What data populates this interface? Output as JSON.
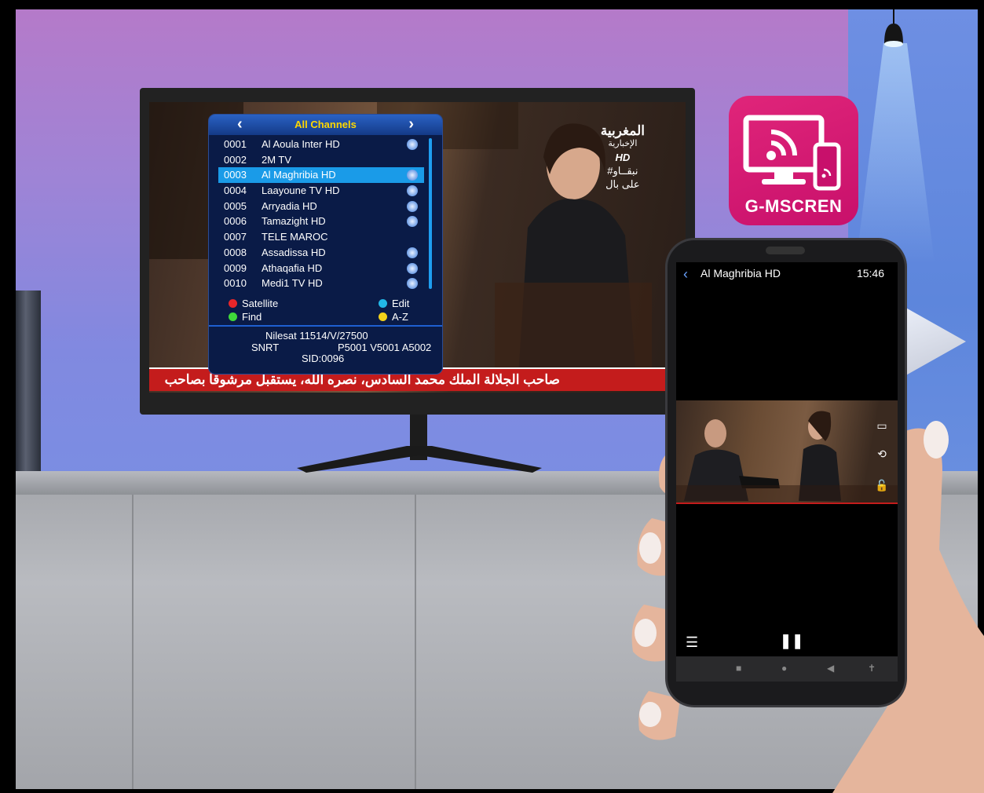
{
  "menu": {
    "title": "All Channels",
    "prev_icon": "chevron-left-icon",
    "next_icon": "chevron-right-icon",
    "channels": [
      {
        "num": "0001",
        "name": "Al Aoula Inter HD",
        "hd": true
      },
      {
        "num": "0002",
        "name": "2M TV",
        "hd": false
      },
      {
        "num": "0003",
        "name": "Al Maghribia HD",
        "hd": true,
        "selected": true
      },
      {
        "num": "0004",
        "name": "Laayoune TV HD",
        "hd": true
      },
      {
        "num": "0005",
        "name": "Arryadia HD",
        "hd": true
      },
      {
        "num": "0006",
        "name": "Tamazight HD",
        "hd": true
      },
      {
        "num": "0007",
        "name": "TELE MAROC",
        "hd": false
      },
      {
        "num": "0008",
        "name": "Assadissa HD",
        "hd": true
      },
      {
        "num": "0009",
        "name": "Athaqafia HD",
        "hd": true
      },
      {
        "num": "0010",
        "name": "Medi1 TV HD",
        "hd": true
      }
    ],
    "keys": {
      "red": {
        "label": "Satellite",
        "color": "#e8262a"
      },
      "blue": {
        "label": "Edit",
        "color": "#22b8e8"
      },
      "green": {
        "label": "Find",
        "color": "#3fd93a"
      },
      "yellow": {
        "label": "A-Z",
        "color": "#f2d21b"
      }
    },
    "info": {
      "line1": "Nilesat 11514/V/27500",
      "provider": "SNRT",
      "pids": "P5001 V5001 A5002",
      "sid": "SID:0096"
    },
    "colors": {
      "background": "#0a1b47",
      "header": "#2a62c4",
      "selected": "#1a9be8",
      "title": "#ffd800"
    }
  },
  "tv": {
    "logo_line1": "المغربية",
    "logo_line2": "الإخبارية",
    "logo_hd": "HD",
    "logo_line3": "#نبقــاو",
    "logo_line4": "على بال",
    "ticker": "صاحب الجلالة الملك محمد السادس، نصره الله، يستقبل مرشوقا بصاحب"
  },
  "app": {
    "name": "G-MSCREN",
    "icon": "screen-cast-icon",
    "color": "#d81b72"
  },
  "phone": {
    "back_icon": "chevron-left-icon",
    "channel_title": "Al Maghribia HD",
    "time": "15:46",
    "controls": [
      "record-icon",
      "rotate-icon",
      "unlock-icon"
    ],
    "list_icon": "list-icon",
    "pause_icon": "pause-icon",
    "nav": [
      "square-icon",
      "home-circle-icon",
      "back-triangle-icon",
      "accessibility-icon"
    ]
  }
}
